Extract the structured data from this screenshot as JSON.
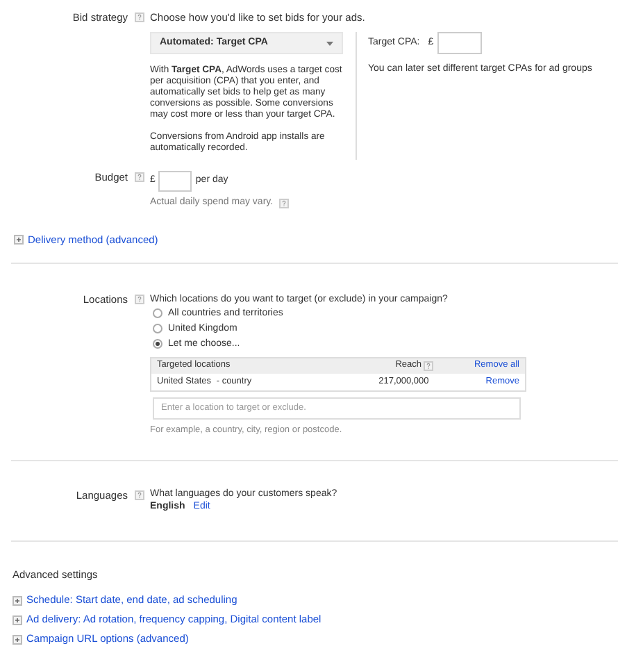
{
  "bid_strategy": {
    "label": "Bid strategy",
    "question": "Choose how you'd like to set bids for your ads.",
    "dropdown": "Automated: Target CPA",
    "description": "With **Target CPA**, AdWords uses a target cost per acquisition (CPA) that you enter, and automatically set bids to help get as many conversions as possible. Some conversions may cost more or less than your target CPA.",
    "note": "Conversions from Android app installs are automatically recorded.",
    "target_label": "Target CPA:",
    "currency": "£",
    "target_hint": "You can later set different target CPAs for ad groups"
  },
  "budget": {
    "label": "Budget",
    "currency": "£",
    "unit": "per day",
    "note": "Actual daily spend may vary."
  },
  "delivery_link": "Delivery method (advanced)",
  "locations": {
    "label": "Locations",
    "question": "Which locations do you want to target (or exclude) in your campaign?",
    "options": [
      {
        "label": "All countries and territories",
        "selected": false
      },
      {
        "label": "United Kingdom",
        "selected": false
      },
      {
        "label": "Let me choose...",
        "selected": true
      }
    ],
    "table": {
      "columns": [
        "Targeted locations",
        "Reach"
      ],
      "remove_all": "Remove all",
      "rows": [
        {
          "name": "United States",
          "type": "- country",
          "reach": "217,000,000",
          "action": "Remove"
        }
      ]
    },
    "search_placeholder": "Enter a location to target or exclude.",
    "example": "For example, a country, city, region or postcode."
  },
  "languages": {
    "label": "Languages",
    "question": "What languages do your customers speak?",
    "value": "English",
    "edit": "Edit"
  },
  "advanced": {
    "title": "Advanced settings",
    "links": [
      "Schedule: Start date, end date, ad scheduling",
      "Ad delivery: Ad rotation, frequency capping, Digital content label",
      "Campaign URL options (advanced)"
    ]
  }
}
